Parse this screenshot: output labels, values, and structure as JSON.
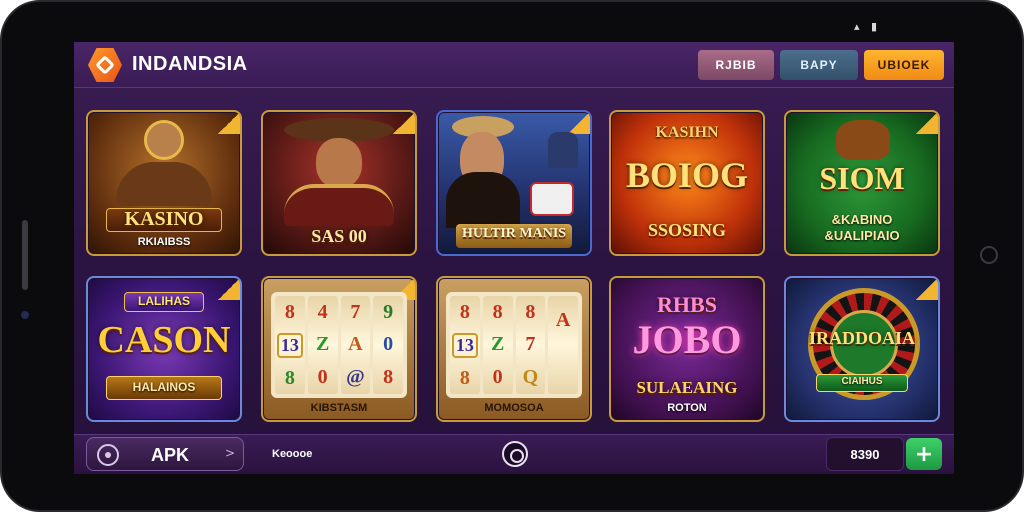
{
  "app": {
    "brand": "INDANDSIA"
  },
  "topbar": {
    "buttons": [
      "RJBIB",
      "BAPY",
      "UBIOEK"
    ]
  },
  "tiles": [
    {
      "title": "KASINO",
      "subtitle": "RKIAIBSS"
    },
    {
      "title": "",
      "subtitle": "SAS 00"
    },
    {
      "title": "",
      "subtitle": "HULTIR MANIS"
    },
    {
      "kicker": "KASIHN",
      "title": "BOIOG",
      "subtitle": "SSOSING"
    },
    {
      "title": "SIOM",
      "subtitle": "&KABINO &UALIPIAIO"
    },
    {
      "kicker": "LALIHAS",
      "title": "CASON",
      "subtitle": "HALAINOS"
    },
    {
      "title": "",
      "subtitle": "KIBSTASM"
    },
    {
      "title": "",
      "subtitle": "MOMOSOA"
    },
    {
      "kicker": "RHBS",
      "title": "JOBO",
      "subtitle": "SULAEAING",
      "footer": "ROTON"
    },
    {
      "title": "IRADDOAIA",
      "subtitle": "CIAIHUS"
    }
  ],
  "reels_a": [
    [
      "8",
      "4",
      "7",
      "9"
    ],
    [
      "13",
      "Z",
      "A",
      "0"
    ],
    [
      "8",
      "0",
      "@",
      "8"
    ]
  ],
  "reels_b": [
    [
      "8",
      "8",
      "8",
      "A"
    ],
    [
      "13",
      "Z",
      "7",
      ""
    ],
    [
      "8",
      "0",
      "Q",
      ""
    ]
  ],
  "bottombar": {
    "apk_label": "APK",
    "text": "Keoooe",
    "balance": "8390"
  },
  "colors": {
    "accent": "#f08a14",
    "bg": "#2c1442",
    "plus": "#1f9a42"
  },
  "icons": [
    "logo-icon",
    "apk-icon",
    "chevron-right-icon",
    "center-circle-icon",
    "plus-icon",
    "status-icons"
  ]
}
